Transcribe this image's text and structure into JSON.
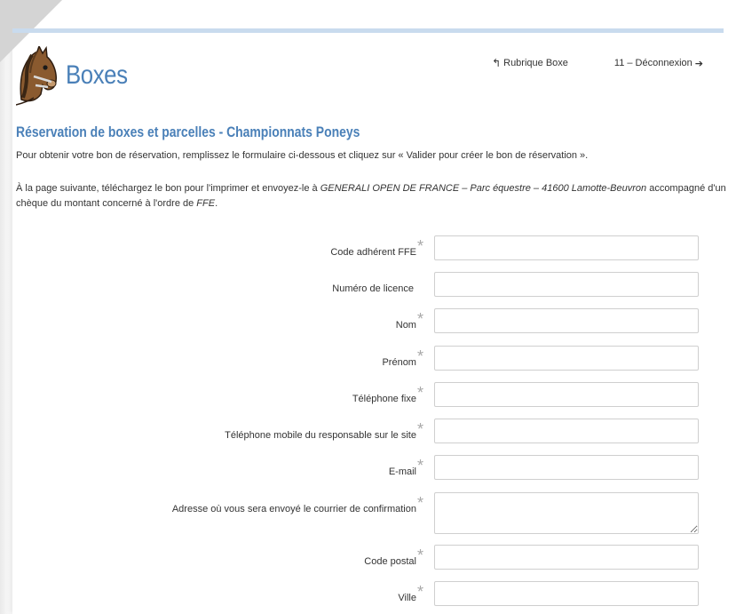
{
  "header": {
    "title": "Boxes",
    "links": {
      "rubrique_label": "Rubrique Boxe",
      "suffix_label": "11 – Déconnexion"
    }
  },
  "intro": {
    "section_title": "Réservation de boxes et parcelles - Championnats Poneys",
    "para1": "Pour obtenir votre bon de réservation, remplissez le formulaire ci-dessous et cliquez sur « Valider pour créer le bon de réservation ».",
    "para2_start": "À la page suivante, téléchargez le bon pour l'imprimer et envoyez-le à ",
    "para2_address": "GENERALI OPEN DE FRANCE – Parc équestre – 41600 Lamotte-Beuvron",
    "para2_middle": " accompagné d'un chèque du montant concerné à l'ordre de ",
    "para2_ffe": "FFE",
    "para2_end": "."
  },
  "form": {
    "fields": [
      {
        "label": "Code adhérent FFE",
        "required": "*"
      },
      {
        "label": "Numéro de licence",
        "required": ""
      },
      {
        "label": "Nom",
        "required": "*"
      },
      {
        "label": "Prénom",
        "required": "*"
      },
      {
        "label": "Téléphone fixe",
        "required": "*"
      },
      {
        "label": "Téléphone mobile du responsable sur le site",
        "required": "*"
      },
      {
        "label": "E-mail",
        "required": "*"
      },
      {
        "label": "Adresse où vous sera envoyé le courrier de confirmation",
        "required": "*"
      },
      {
        "label": "Code postal",
        "required": "*"
      },
      {
        "label": "Ville",
        "required": "*"
      }
    ]
  },
  "icons": {
    "back": "reply-arrow-icon",
    "logout": "logout-icon",
    "logo": "horse-logo-icon"
  },
  "colors": {
    "accent": "#4a80b8",
    "top_bar": "#c9dbee"
  }
}
